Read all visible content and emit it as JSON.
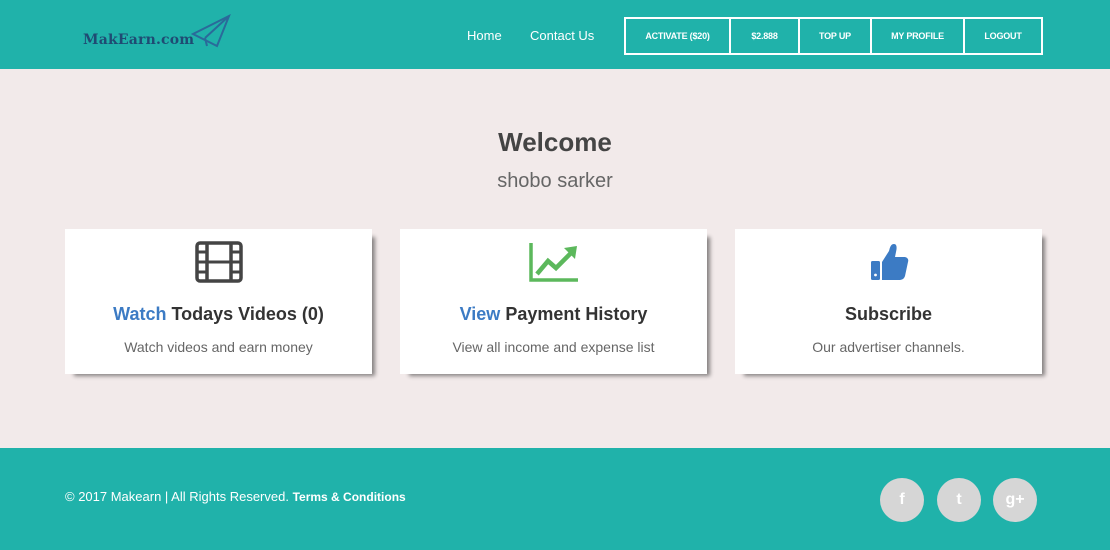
{
  "header": {
    "logo_text": "MakEarn.com",
    "nav": {
      "home": "Home",
      "contact": "Contact Us"
    },
    "buttons": [
      "ACTIVATE ($20)",
      "$2.888",
      "TOP UP",
      "MY PROFILE",
      "LOGOUT"
    ]
  },
  "welcome": {
    "title": "Welcome",
    "username": "shobo sarker"
  },
  "cards": [
    {
      "icon": "film-icon",
      "accent": "Watch",
      "title": " Todays Videos (0)",
      "subtitle": "Watch videos and earn money"
    },
    {
      "icon": "trending-up-icon",
      "accent": "View",
      "title": " Payment History",
      "subtitle": "View all income and expense list"
    },
    {
      "icon": "thumbs-up-icon",
      "accent": "",
      "title": "Subscribe",
      "subtitle": "Our advertiser channels."
    }
  ],
  "footer": {
    "copyright": "© 2017 Makearn | All Rights Reserved. ",
    "terms": "Terms & Conditions",
    "social": [
      "f",
      "t",
      "g+"
    ]
  },
  "colors": {
    "header_bg": "#20b2aa",
    "page_bg": "#f2eaea",
    "accent_blue": "#3c7bc4",
    "chart_green": "#5cb85c",
    "logo_navy": "#1f4b73"
  }
}
